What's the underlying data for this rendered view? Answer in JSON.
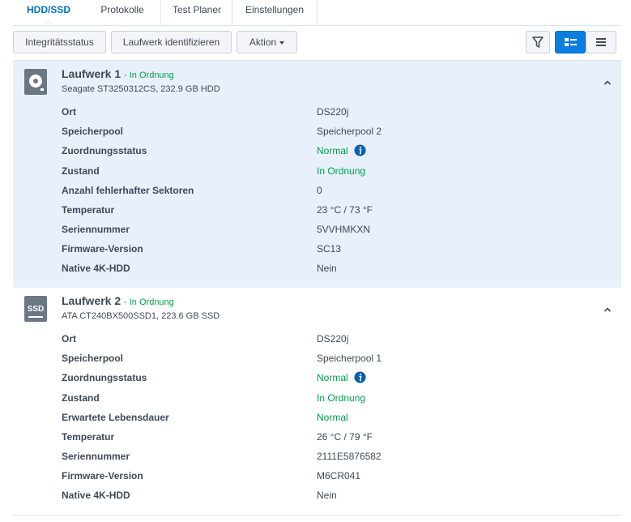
{
  "tabs": [
    {
      "label": "HDD/SSD"
    },
    {
      "label": "Protokolle"
    },
    {
      "label": "Test Planer"
    },
    {
      "label": "Einstellungen"
    }
  ],
  "toolbar": {
    "integrity_label": "Integritätsstatus",
    "identify_label": "Laufwerk identifizieren",
    "action_label": "Aktion"
  },
  "drives": [
    {
      "name": "Laufwerk 1",
      "status": "- In Ordnung",
      "subtitle": "Seagate ST3250312CS, 232.9 GB HDD",
      "icon": "hdd-icon",
      "rows": [
        {
          "label": "Ort",
          "value": "DS220j"
        },
        {
          "label": "Speicherpool",
          "value": "Speicherpool 2"
        },
        {
          "label": "Zuordnungsstatus",
          "value": "Normal"
        },
        {
          "label": "Zustand",
          "value": "In Ordnung"
        },
        {
          "label": "Anzahl fehlerhafter Sektoren",
          "value": "0"
        },
        {
          "label": "Temperatur",
          "value": "23 °C / 73 °F"
        },
        {
          "label": "Seriennummer",
          "value": "5VVHMKXN"
        },
        {
          "label": "Firmware-Version",
          "value": "SC13"
        },
        {
          "label": "Native 4K-HDD",
          "value": "Nein"
        }
      ]
    },
    {
      "name": "Laufwerk 2",
      "status": "- In Ordnung",
      "subtitle": "ATA CT240BX500SSD1, 223.6 GB SSD",
      "icon": "ssd-icon",
      "icon_text": "SSD",
      "rows": [
        {
          "label": "Ort",
          "value": "DS220j"
        },
        {
          "label": "Speicherpool",
          "value": "Speicherpool 1"
        },
        {
          "label": "Zuordnungsstatus",
          "value": "Normal"
        },
        {
          "label": "Zustand",
          "value": "In Ordnung"
        },
        {
          "label": "Erwartete Lebensdauer",
          "value": "Normal"
        },
        {
          "label": "Temperatur",
          "value": "26 °C / 79 °F"
        },
        {
          "label": "Seriennummer",
          "value": "2111E5876582"
        },
        {
          "label": "Firmware-Version",
          "value": "M6CR041"
        },
        {
          "label": "Native 4K-HDD",
          "value": "Nein"
        }
      ]
    }
  ],
  "colors": {
    "accent": "#0072c6",
    "ok_green": "#00a14b",
    "expanded_bg": "#e8f1fb"
  }
}
